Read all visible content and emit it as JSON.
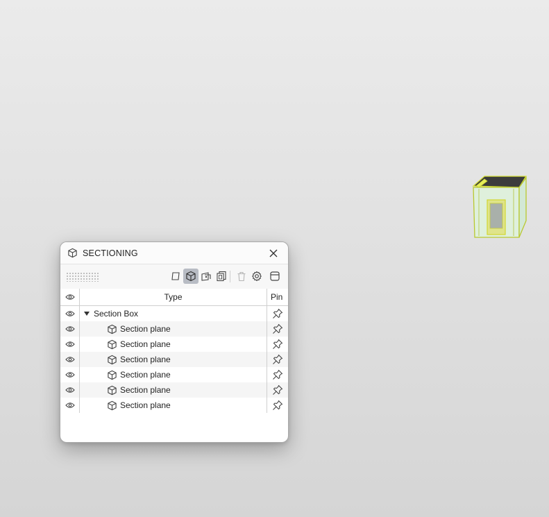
{
  "panel": {
    "title": "SECTIONING"
  },
  "toolbar": {
    "buttons": [
      {
        "name": "add-section-plane",
        "icon": "plane-icon"
      },
      {
        "name": "add-section-box",
        "icon": "cube-icon",
        "active": true
      },
      {
        "name": "add-section-plane-from-face",
        "icon": "face-plane-icon"
      },
      {
        "name": "add-section-box-from-selection",
        "icon": "layered-boxes-icon"
      },
      {
        "name": "delete",
        "icon": "trash-icon",
        "disabled": true
      },
      {
        "name": "settings",
        "icon": "gear-icon"
      },
      {
        "name": "toggle-panel",
        "icon": "panel-icon"
      }
    ]
  },
  "table": {
    "headers": {
      "type": "Type",
      "pin": "Pin"
    },
    "group": {
      "label": "Section Box",
      "expanded": true
    },
    "items": [
      {
        "label": "Section plane"
      },
      {
        "label": "Section plane"
      },
      {
        "label": "Section plane"
      },
      {
        "label": "Section plane"
      },
      {
        "label": "Section plane"
      },
      {
        "label": "Section plane"
      }
    ]
  },
  "colors": {
    "active_button": "#b8bcc4",
    "highlight_yellow": "#e8f04a",
    "icon_gray": "#555555"
  }
}
